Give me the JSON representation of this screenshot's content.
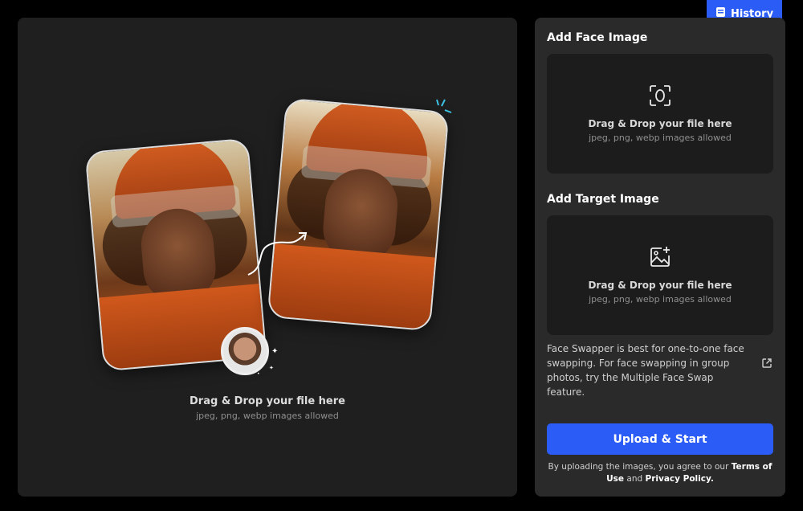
{
  "header": {
    "history_label": "History",
    "history_icon": "history-icon"
  },
  "preview": {
    "drop_label": "Drag & Drop your file here",
    "drop_sub": "jpeg, png, webp images allowed"
  },
  "face_section": {
    "title": "Add Face Image",
    "icon": "face-scan-icon",
    "drop_label": "Drag & Drop your file here",
    "drop_sub": "jpeg, png, webp images allowed"
  },
  "target_section": {
    "title": "Add Target Image",
    "icon": "image-add-icon",
    "drop_label": "Drag & Drop your file here",
    "drop_sub": "jpeg, png, webp images allowed"
  },
  "note": {
    "text": "Face Swapper is best for one-to-one face swapping. For face swapping in group photos, try the Multiple Face Swap feature.",
    "icon": "external-link-icon"
  },
  "actions": {
    "upload_label": "Upload & Start"
  },
  "legal": {
    "prefix": "By uploading the images, you agree to our ",
    "terms": "Terms of Use",
    "and": " and ",
    "privacy": "Privacy Policy."
  },
  "colors": {
    "accent": "#2b5cf5",
    "panel": "#2a2a2a",
    "dropzone": "#1c1c1c"
  }
}
